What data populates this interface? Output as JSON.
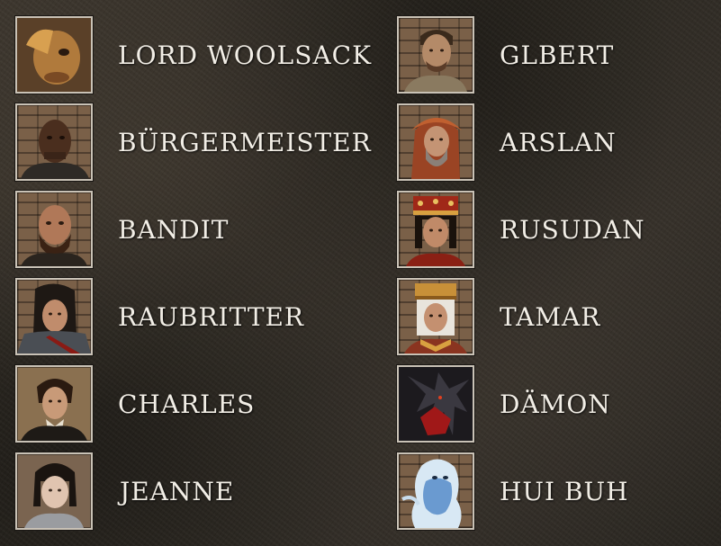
{
  "characters_left": [
    {
      "name": "LORD WOOLSACK",
      "portrait": "lord-woolsack-portrait"
    },
    {
      "name": "BÜRGERMEISTER",
      "portrait": "buergermeister-portrait"
    },
    {
      "name": "BANDIT",
      "portrait": "bandit-portrait"
    },
    {
      "name": "RAUBRITTER",
      "portrait": "raubritter-portrait"
    },
    {
      "name": "CHARLES",
      "portrait": "charles-portrait"
    },
    {
      "name": "JEANNE",
      "portrait": "jeanne-portrait"
    }
  ],
  "characters_right": [
    {
      "name": "GLBERT",
      "portrait": "glbert-portrait"
    },
    {
      "name": "ARSLAN",
      "portrait": "arslan-portrait"
    },
    {
      "name": "RUSUDAN",
      "portrait": "rusudan-portrait"
    },
    {
      "name": "TAMAR",
      "portrait": "tamar-portrait"
    },
    {
      "name": "DÄMON",
      "portrait": "daemon-portrait"
    },
    {
      "name": "HUI BUH",
      "portrait": "hui-buh-portrait"
    }
  ],
  "colors": {
    "background": "#2b2720",
    "text": "#f2eee6",
    "frame": "#c9c2b6"
  }
}
